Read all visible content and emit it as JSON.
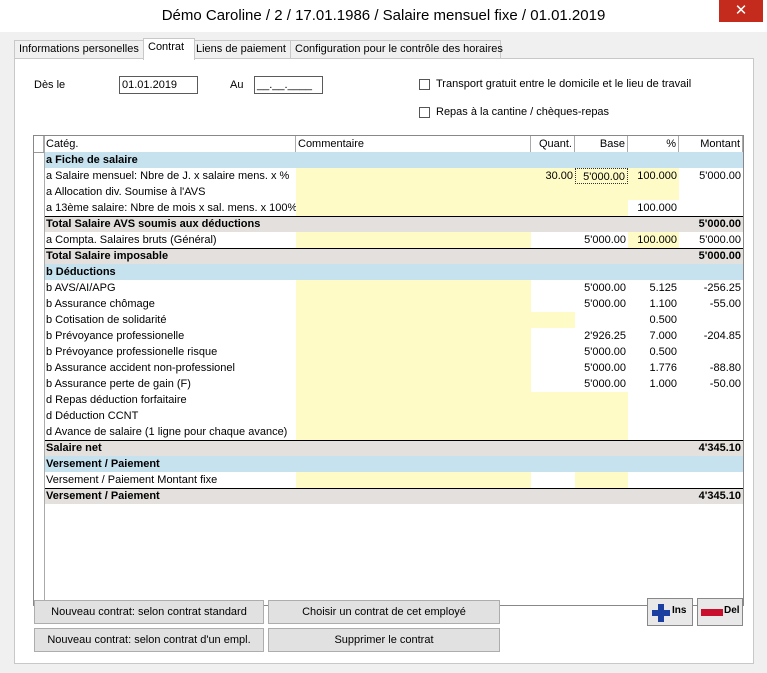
{
  "window": {
    "title": "Démo Caroline / 2 / 17.01.1986 / Salaire mensuel fixe / 01.01.2019",
    "close_glyph": "✕"
  },
  "tabs": [
    {
      "label": "Informations personelles"
    },
    {
      "label": "Contrat"
    },
    {
      "label": "Liens de paiement"
    },
    {
      "label": "Configuration pour le contrôle des horaires"
    }
  ],
  "form": {
    "from_label": "Dès le",
    "from_value": "01.01.2019",
    "to_label": "Au",
    "to_value": "__.__.____",
    "transport_label": "Transport gratuit entre le domicile et le lieu de travail",
    "transport_checked": false,
    "meals_label": "Repas à la cantine / chèques-repas",
    "meals_checked": false
  },
  "colors": {
    "section": "#c6e2ee",
    "total": "#e3e0de",
    "input_yellow": "#fffbc6",
    "close": "#c42b1c"
  },
  "table": {
    "columns": [
      "",
      "Catég.",
      "Commentaire",
      "Quant.",
      "Base",
      "%",
      "Montant"
    ],
    "rows": [
      {
        "type": "section",
        "cat": "a  Fiche de salaire"
      },
      {
        "type": "item",
        "cat": "a  Salaire mensuel: Nbre de J. x salaire mens. x %",
        "comm": "",
        "quant": "30.00",
        "base": "5'000.00",
        "pct": "100.000",
        "amount": "5'000.00",
        "ye": [
          1,
          1,
          1,
          1
        ],
        "selected_base": true
      },
      {
        "type": "item",
        "cat": "a  Allocation div. Soumise à l'AVS",
        "comm": "",
        "quant": "",
        "base": "",
        "pct": "",
        "amount": "",
        "ye": [
          1,
          1,
          1,
          1
        ]
      },
      {
        "type": "item",
        "cat": "a  13ème salaire: Nbre de mois x sal. mens. x 100%",
        "comm": "",
        "quant": "",
        "base": "",
        "pct": "100.000",
        "amount": "",
        "ye": [
          1,
          1,
          1,
          0
        ]
      },
      {
        "type": "total",
        "cat": "Total Salaire AVS soumis aux déductions",
        "amount": "5'000.00"
      },
      {
        "type": "item",
        "cat": "a  Compta. Salaires bruts (Général)",
        "comm": "",
        "quant": "",
        "base": "5'000.00",
        "pct": "100.000",
        "amount": "5'000.00",
        "ye": [
          1,
          0,
          0,
          1
        ]
      },
      {
        "type": "total",
        "cat": "Total Salaire imposable",
        "amount": "5'000.00"
      },
      {
        "type": "section",
        "cat": "b  Déductions"
      },
      {
        "type": "item",
        "cat": "b  AVS/AI/APG",
        "comm": "",
        "quant": "",
        "base": "5'000.00",
        "pct": "5.125",
        "amount": "-256.25",
        "ye": [
          1,
          0,
          0,
          0
        ]
      },
      {
        "type": "item",
        "cat": "b  Assurance chômage",
        "comm": "",
        "quant": "",
        "base": "5'000.00",
        "pct": "1.100",
        "amount": "-55.00",
        "ye": [
          1,
          0,
          0,
          0
        ]
      },
      {
        "type": "item",
        "cat": "b  Cotisation de solidarité",
        "comm": "",
        "quant": "",
        "base": "",
        "pct": "0.500",
        "amount": "",
        "ye": [
          1,
          1,
          0,
          0
        ]
      },
      {
        "type": "item",
        "cat": "b  Prévoyance professionelle",
        "comm": "",
        "quant": "",
        "base": "2'926.25",
        "pct": "7.000",
        "amount": "-204.85",
        "ye": [
          1,
          0,
          0,
          0
        ]
      },
      {
        "type": "item",
        "cat": "b  Prévoyance professionelle risque",
        "comm": "",
        "quant": "",
        "base": "5'000.00",
        "pct": "0.500",
        "amount": "",
        "ye": [
          1,
          0,
          0,
          0
        ]
      },
      {
        "type": "item",
        "cat": "b  Assurance accident non-professionel",
        "comm": "",
        "quant": "",
        "base": "5'000.00",
        "pct": "1.776",
        "amount": "-88.80",
        "ye": [
          1,
          0,
          0,
          0
        ]
      },
      {
        "type": "item",
        "cat": "b  Assurance perte de gain (F)",
        "comm": "",
        "quant": "",
        "base": "5'000.00",
        "pct": "1.000",
        "amount": "-50.00",
        "ye": [
          1,
          0,
          0,
          0
        ]
      },
      {
        "type": "item",
        "cat": "d  Repas déduction forfaitaire",
        "comm": "",
        "quant": "",
        "base": "",
        "pct": "",
        "amount": "",
        "ye": [
          1,
          1,
          1,
          0
        ]
      },
      {
        "type": "item",
        "cat": "d  Déduction CCNT",
        "comm": "",
        "quant": "",
        "base": "",
        "pct": "",
        "amount": "",
        "ye": [
          1,
          1,
          1,
          0
        ]
      },
      {
        "type": "item",
        "cat": "d  Avance de salaire (1 ligne pour chaque avance)",
        "comm": "",
        "quant": "",
        "base": "",
        "pct": "",
        "amount": "",
        "ye": [
          1,
          1,
          1,
          0
        ]
      },
      {
        "type": "total",
        "cat": "Salaire net",
        "amount": "4'345.10"
      },
      {
        "type": "section",
        "cat": "Versement / Paiement"
      },
      {
        "type": "item",
        "cat": "Versement / Paiement Montant fixe",
        "comm": "",
        "quant": "",
        "base": "",
        "pct": "",
        "amount": "",
        "ye": [
          1,
          0,
          1,
          0
        ]
      },
      {
        "type": "total",
        "cat": "Versement / Paiement",
        "amount": "4'345.10"
      }
    ]
  },
  "buttons": {
    "new_standard": "Nouveau contrat: selon contrat standard",
    "choose_contract": "Choisir un contrat de cet employé",
    "new_from_employee": "Nouveau contrat: selon contrat d'un empl.",
    "delete_contract": "Supprimer le contrat",
    "ins": "Ins",
    "del": "Del"
  }
}
